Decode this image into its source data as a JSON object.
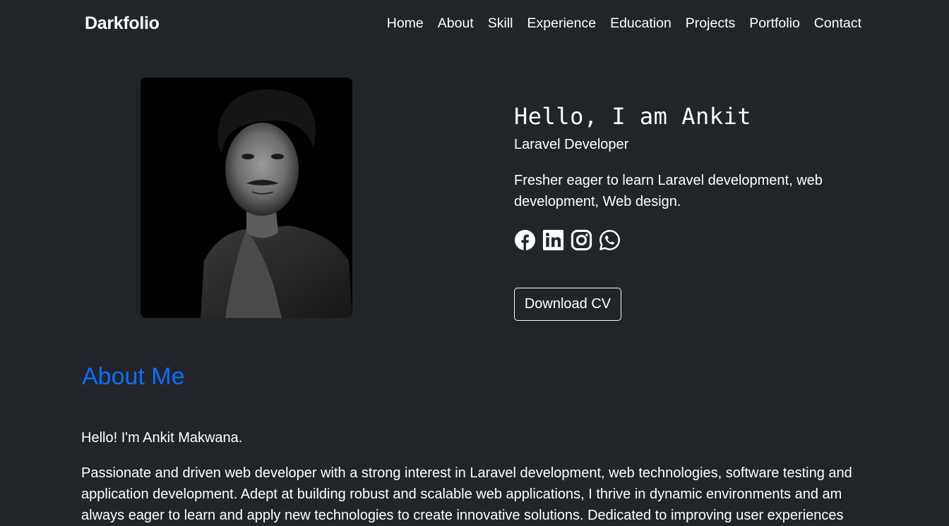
{
  "navbar": {
    "brand": "Darkfolio",
    "links": [
      "Home",
      "About",
      "Skill",
      "Experience",
      "Education",
      "Projects",
      "Portfolio",
      "Contact"
    ]
  },
  "hero": {
    "greeting": "Hello, I am Ankit",
    "role": "Laravel Developer",
    "summary": "Fresher eager to learn Laravel development, web development, Web design.",
    "socials": [
      "facebook-icon",
      "linkedin-icon",
      "instagram-icon",
      "whatsapp-icon"
    ],
    "download_label": "Download CV"
  },
  "about": {
    "heading": "About Me",
    "hello": "Hello! I'm Ankit Makwana.",
    "body": "Passionate and driven web developer with a strong interest in Laravel development, web technologies, software testing and application development. Adept at building robust and scalable web applications, I thrive in dynamic environments and am always eager to learn and apply new technologies to create innovative solutions. Dedicated to improving user experiences"
  },
  "colors": {
    "background": "#212529",
    "text": "#ffffff",
    "accent": "#0d6efd"
  }
}
